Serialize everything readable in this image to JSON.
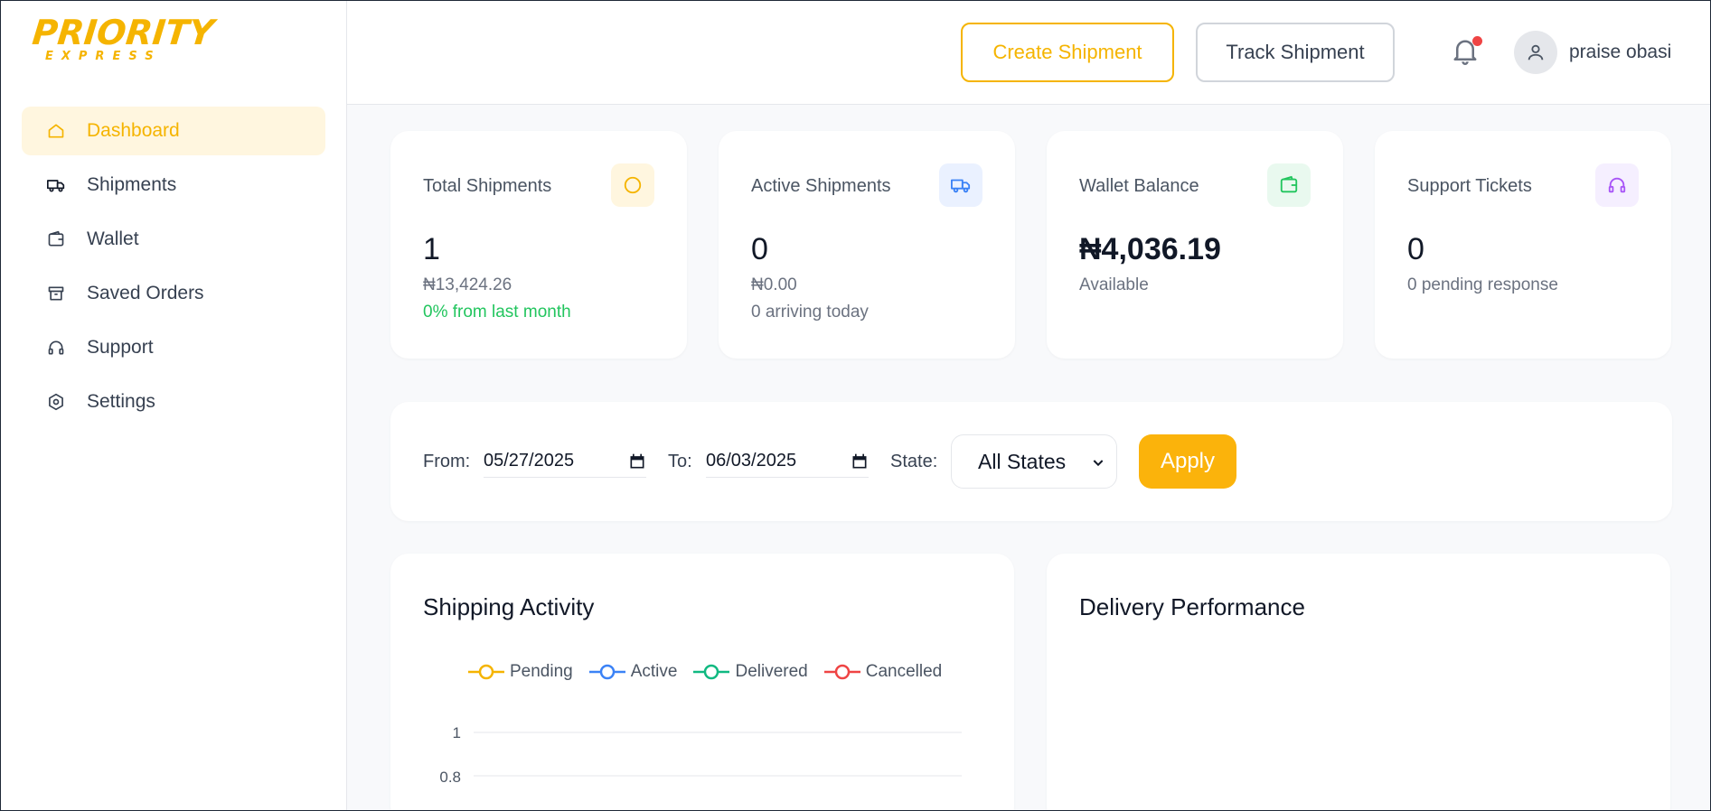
{
  "brand": {
    "logo_main": "PRIORITY",
    "logo_sub": "EXPRESS",
    "color": "#f5b400"
  },
  "sidebar": {
    "items": [
      {
        "label": "Dashboard",
        "icon": "home-icon",
        "active": true
      },
      {
        "label": "Shipments",
        "icon": "truck-icon",
        "active": false
      },
      {
        "label": "Wallet",
        "icon": "wallet-icon",
        "active": false
      },
      {
        "label": "Saved Orders",
        "icon": "archive-icon",
        "active": false
      },
      {
        "label": "Support",
        "icon": "headset-icon",
        "active": false
      },
      {
        "label": "Settings",
        "icon": "gear-icon",
        "active": false
      }
    ]
  },
  "header": {
    "create_label": "Create Shipment",
    "track_label": "Track Shipment",
    "notification_icon": "bell-icon",
    "username": "praise obasi"
  },
  "stats": [
    {
      "title": "Total Shipments",
      "value": "1",
      "sub1": "₦13,424.26",
      "sub2": "0% from last month",
      "icon": "circle-icon",
      "icon_bg": "#fff6df",
      "icon_color": "#f5b400"
    },
    {
      "title": "Active Shipments",
      "value": "0",
      "sub1": "₦0.00",
      "sub2": "0 arriving today",
      "icon": "truck-icon",
      "icon_bg": "#eaf1ff",
      "icon_color": "#3b82f6"
    },
    {
      "title": "Wallet Balance",
      "value": "₦4,036.19",
      "sub1": "Available",
      "sub2": "",
      "icon": "wallet-icon",
      "icon_bg": "#e9f9ef",
      "icon_color": "#22c55e"
    },
    {
      "title": "Support Tickets",
      "value": "0",
      "sub1": "0 pending response",
      "sub2": "",
      "icon": "headset-icon",
      "icon_bg": "#f5efff",
      "icon_color": "#a855f7"
    }
  ],
  "filter": {
    "from_label": "From:",
    "from_value": "05/27/2025",
    "to_label": "To:",
    "to_value": "06/03/2025",
    "state_label": "State:",
    "state_value": "All States",
    "apply_label": "Apply"
  },
  "charts": {
    "activity_title": "Shipping Activity",
    "performance_title": "Delivery Performance"
  },
  "chart_data": {
    "type": "line",
    "title": "Shipping Activity",
    "series": [
      {
        "name": "Pending",
        "color": "#f5b400",
        "values": []
      },
      {
        "name": "Active",
        "color": "#3b82f6",
        "values": []
      },
      {
        "name": "Delivered",
        "color": "#10b981",
        "values": []
      },
      {
        "name": "Cancelled",
        "color": "#ef4444",
        "values": []
      }
    ],
    "yticks": [
      "1",
      "0.8"
    ],
    "grid": true,
    "legend": "top"
  }
}
